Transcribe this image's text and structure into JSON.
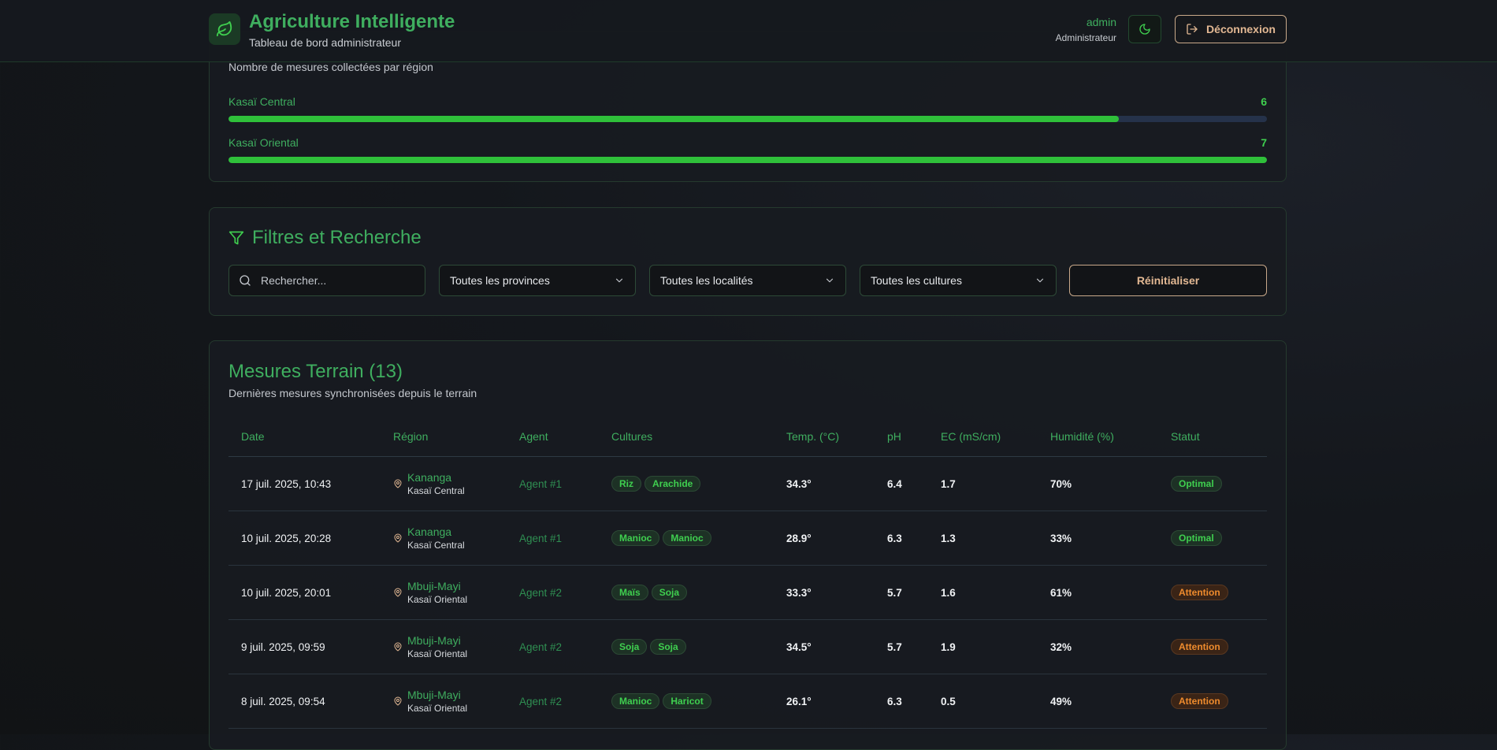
{
  "header": {
    "title": "Agriculture Intelligente",
    "subtitle": "Tableau de bord administrateur",
    "user_name": "admin",
    "user_role": "Administrateur",
    "logout_label": "Déconnexion"
  },
  "regions_card": {
    "description": "Nombre de mesures collectées par région",
    "regions": [
      {
        "name": "Kasaï Central",
        "count": "6",
        "fill_fraction": 0.857
      },
      {
        "name": "Kasaï Oriental",
        "count": "7",
        "fill_fraction": 1.0
      }
    ]
  },
  "filters": {
    "title": "Filtres et Recherche",
    "search_placeholder": "Rechercher...",
    "province_select": "Toutes les provinces",
    "locality_select": "Toutes les localités",
    "culture_select": "Toutes les cultures",
    "reset_label": "Réinitialiser"
  },
  "measures": {
    "title": "Mesures Terrain (13)",
    "description": "Dernières mesures synchronisées depuis le terrain",
    "columns": [
      "Date",
      "Région",
      "Agent",
      "Cultures",
      "Temp. (°C)",
      "pH",
      "EC (mS/cm)",
      "Humidité (%)",
      "Statut"
    ],
    "rows": [
      {
        "date": "17 juil. 2025, 10:43",
        "locality": "Kananga",
        "province": "Kasaï Central",
        "agent": "Agent #1",
        "cultures": [
          "Riz",
          "Arachide"
        ],
        "temp": "34.3°",
        "ph": "6.4",
        "ec": "1.7",
        "humidity": "70%",
        "status": "Optimal",
        "status_type": "ok"
      },
      {
        "date": "10 juil. 2025, 20:28",
        "locality": "Kananga",
        "province": "Kasaï Central",
        "agent": "Agent #1",
        "cultures": [
          "Manioc",
          "Manioc"
        ],
        "temp": "28.9°",
        "ph": "6.3",
        "ec": "1.3",
        "humidity": "33%",
        "status": "Optimal",
        "status_type": "ok"
      },
      {
        "date": "10 juil. 2025, 20:01",
        "locality": "Mbuji-Mayi",
        "province": "Kasaï Oriental",
        "agent": "Agent #2",
        "cultures": [
          "Maïs",
          "Soja"
        ],
        "temp": "33.3°",
        "ph": "5.7",
        "ec": "1.6",
        "humidity": "61%",
        "status": "Attention",
        "status_type": "warn"
      },
      {
        "date": "9 juil. 2025, 09:59",
        "locality": "Mbuji-Mayi",
        "province": "Kasaï Oriental",
        "agent": "Agent #2",
        "cultures": [
          "Soja",
          "Soja"
        ],
        "temp": "34.5°",
        "ph": "5.7",
        "ec": "1.9",
        "humidity": "32%",
        "status": "Attention",
        "status_type": "warn"
      },
      {
        "date": "8 juil. 2025, 09:54",
        "locality": "Mbuji-Mayi",
        "province": "Kasaï Oriental",
        "agent": "Agent #2",
        "cultures": [
          "Manioc",
          "Haricot"
        ],
        "temp": "26.1°",
        "ph": "6.3",
        "ec": "0.5",
        "humidity": "49%",
        "status": "Attention",
        "status_type": "warn"
      }
    ]
  }
}
